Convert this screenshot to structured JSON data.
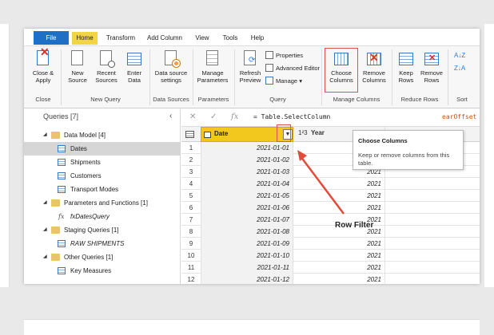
{
  "ribbon_tabs": [
    "File",
    "Home",
    "Transform",
    "Add Column",
    "View",
    "Tools",
    "Help"
  ],
  "ribbon": {
    "close_apply": "Close &\nApply",
    "new_source": "New\nSource",
    "recent_sources": "Recent\nSources",
    "enter_data": "Enter\nData",
    "data_source_settings": "Data source\nsettings",
    "manage_parameters": "Manage\nParameters",
    "refresh_preview": "Refresh\nPreview",
    "properties": "Properties",
    "advanced_editor": "Advanced Editor",
    "manage": "Manage",
    "choose_columns": "Choose\nColumns",
    "remove_columns": "Remove\nColumns",
    "keep_rows": "Keep\nRows",
    "remove_rows": "Remove\nRows",
    "groups": [
      "Close",
      "New Query",
      "Data Sources",
      "Parameters",
      "Query",
      "Manage Columns",
      "Reduce Rows",
      "Sort"
    ]
  },
  "queries": {
    "title": "Queries [7]",
    "items": [
      {
        "label": "Data Model [4]",
        "kind": "folder"
      },
      {
        "label": "Dates",
        "kind": "table",
        "selected": true
      },
      {
        "label": "Shipments",
        "kind": "table"
      },
      {
        "label": "Customers",
        "kind": "table"
      },
      {
        "label": "Transport Modes",
        "kind": "table"
      },
      {
        "label": "Parameters and Functions [1]",
        "kind": "folder"
      },
      {
        "label": "fxDatesQuery",
        "kind": "function"
      },
      {
        "label": "Staging Queries [1]",
        "kind": "folder"
      },
      {
        "label": "RAW SHIPMENTS",
        "kind": "table"
      },
      {
        "label": "Other Queries [1]",
        "kind": "folder"
      },
      {
        "label": "Key Measures",
        "kind": "table"
      }
    ]
  },
  "formula": {
    "fx": "fx",
    "text": "= Table.SelectColumn",
    "tail": "earOffset"
  },
  "grid": {
    "columns": [
      "Date",
      "Year"
    ],
    "year_type": "1²3",
    "rows": [
      {
        "n": "1",
        "date": "2021-01-01",
        "year": "2021"
      },
      {
        "n": "2",
        "date": "2021-01-02",
        "year": "2021"
      },
      {
        "n": "3",
        "date": "2021-01-03",
        "year": "2021"
      },
      {
        "n": "4",
        "date": "2021-01-04",
        "year": "2021"
      },
      {
        "n": "5",
        "date": "2021-01-05",
        "year": "2021"
      },
      {
        "n": "6",
        "date": "2021-01-06",
        "year": "2021"
      },
      {
        "n": "7",
        "date": "2021-01-07",
        "year": "2021"
      },
      {
        "n": "8",
        "date": "2021-01-08",
        "year": "2021"
      },
      {
        "n": "9",
        "date": "2021-01-09",
        "year": "2021"
      },
      {
        "n": "10",
        "date": "2021-01-10",
        "year": "2021"
      },
      {
        "n": "11",
        "date": "2021-01-11",
        "year": "2021"
      },
      {
        "n": "12",
        "date": "2021-01-12",
        "year": "2021"
      }
    ]
  },
  "tooltip": {
    "title": "Choose Columns",
    "desc": "Keep or remove columns from this table."
  },
  "annotation": "Row Filter",
  "colors": {
    "accent_yellow": "#f2c81e",
    "file_blue": "#1e6fc6",
    "highlight_red": "#d9534f"
  }
}
